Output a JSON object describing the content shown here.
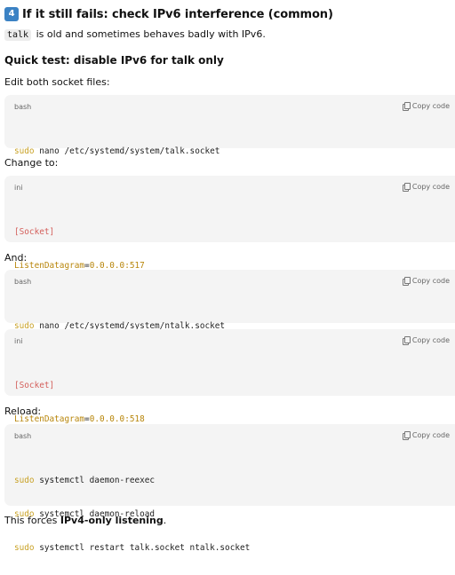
{
  "heading": {
    "emoji": "4️⃣",
    "text": "If it still fails: check IPv6 interference (common)"
  },
  "intro": {
    "code": "talk",
    "text": "is old and sometimes behaves badly with IPv6."
  },
  "subheading": "Quick test: disable IPv6 for talk only",
  "copy_label": "Copy code",
  "labels": {
    "edit": "Edit both socket files:",
    "change": "Change to:",
    "and": "And:",
    "reload": "Reload:"
  },
  "blocks": [
    {
      "lang": "bash",
      "lines": [
        {
          "kw": "sudo",
          "rest": " nano /etc/systemd/system/talk.socket"
        }
      ]
    },
    {
      "lang": "ini",
      "section": "[Socket]",
      "key": "ListenDatagram",
      "eq": "=",
      "value": "0.0.0.0:517"
    },
    {
      "lang": "bash",
      "lines": [
        {
          "kw": "sudo",
          "rest": " nano /etc/systemd/system/ntalk.socket"
        }
      ]
    },
    {
      "lang": "ini",
      "section": "[Socket]",
      "key": "ListenDatagram",
      "eq": "=",
      "value": "0.0.0.0:518"
    },
    {
      "lang": "bash",
      "lines": [
        {
          "kw": "sudo",
          "rest": " systemctl daemon-reexec"
        },
        {
          "kw": "sudo",
          "rest": " systemctl daemon-reload"
        },
        {
          "kw": "sudo",
          "rest": " systemctl restart talk.socket ntalk.socket"
        }
      ]
    }
  ],
  "footer": {
    "prefix": "This forces ",
    "bold": "IPv4-only listening",
    "suffix": "."
  }
}
